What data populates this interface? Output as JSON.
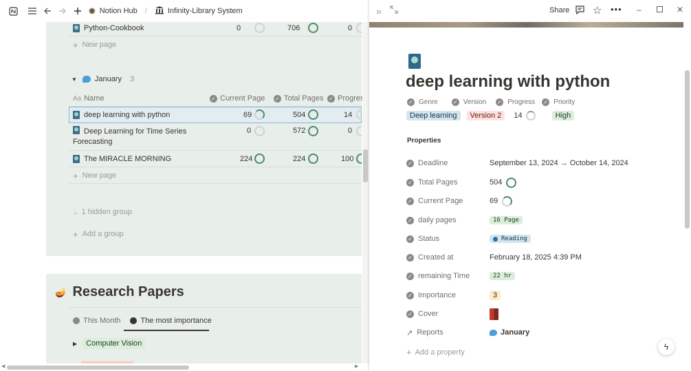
{
  "breadcrumb": {
    "workspace": "Notion Hub",
    "page": "Infinity-Library System"
  },
  "board": {
    "top_row": {
      "name": "Python-Cookbook",
      "current": "0",
      "total": "706",
      "progress": "0"
    },
    "new_page_label": "New page",
    "group": {
      "name": "January",
      "count": "3"
    },
    "columns": {
      "name": "Name",
      "current": "Current Page",
      "total": "Total Pages",
      "progress": "Progres"
    },
    "rows": [
      {
        "name": "deep learning with python",
        "current": "69",
        "total": "504",
        "progress": "14"
      },
      {
        "name": "Deep Learning for Time Series",
        "name2": "Forecasting",
        "current": "0",
        "total": "572",
        "progress": "0"
      },
      {
        "name": "The MIRACLE MORNING",
        "current": "224",
        "total": "224",
        "progress": "100"
      }
    ],
    "hidden_group": "1 hidden group",
    "add_group": "Add a group"
  },
  "research": {
    "title": "Research Papers",
    "tabs": [
      "This Month",
      "The most importance"
    ],
    "group_label": "Computer Vision"
  },
  "panel": {
    "share_label": "Share",
    "title": "deep learning with python",
    "header_props": {
      "labels": [
        "Genre",
        "Version",
        "Progress",
        "Priority"
      ],
      "genre": "Deep learning",
      "version": "Version 2",
      "progress": "14",
      "priority": "High"
    },
    "properties_heading": "Properties",
    "props": [
      {
        "name": "Deadline",
        "value": "September 13, 2024 → October 14, 2024"
      },
      {
        "name": "Total Pages",
        "value": "504"
      },
      {
        "name": "Current Page",
        "value": "69"
      },
      {
        "name": "daily pages",
        "value": "16 Page"
      },
      {
        "name": "Status",
        "value": "Reading"
      },
      {
        "name": "Created at",
        "value": "February 18, 2025 4:39 PM"
      },
      {
        "name": "remaining Time",
        "value": "22 hr"
      },
      {
        "name": "Importance",
        "value": "3"
      },
      {
        "name": "Cover",
        "value": ""
      },
      {
        "name": "Reports",
        "value": "January"
      }
    ],
    "add_property": "Add a property"
  },
  "colors": {
    "canvas": "#e8eee9",
    "ring": "#4a8a6a",
    "genre_tag": "#d3e5ef",
    "version_tag": "#ffe2dd",
    "priority_tag": "#dbeddb",
    "status_tag": "#d3e5ef",
    "importance_tag": "#fdecc8"
  }
}
